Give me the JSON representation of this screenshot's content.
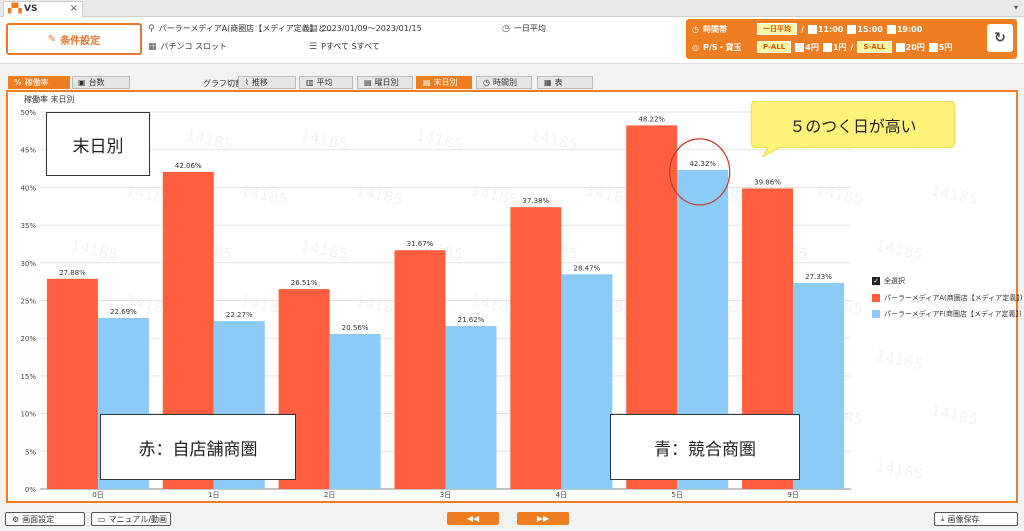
{
  "window": {
    "tab_title": "VS",
    "close": "×",
    "menu_arrow": "▾"
  },
  "header": {
    "condition_button": "条件設定",
    "store": "パーラーメディアA(商圏店【メディア定義】と...",
    "period": "2023/01/09～2023/01/15",
    "average": "一日平均",
    "machine_type": "パチンコ スロット",
    "machine_filter": "Pすべて Sすべて"
  },
  "time_panel": {
    "label_time": "時間帯",
    "time_options": [
      {
        "label": "一日平均",
        "selected": true
      },
      {
        "label": "11:00",
        "selected": false
      },
      {
        "label": "15:00",
        "selected": false
      },
      {
        "label": "19:00",
        "selected": false
      }
    ],
    "label_rate": "P/S・貸玉",
    "p_all": "P-ALL",
    "p_options": [
      "4円",
      "1円"
    ],
    "s_all": "S-ALL",
    "s_options": [
      "20円",
      "5円"
    ],
    "separator": "/"
  },
  "tabs": {
    "metric": [
      {
        "label": "稼働率",
        "active": true
      },
      {
        "label": "台数",
        "active": false
      }
    ],
    "graph_switch_label": "グラフ切替",
    "graph": [
      {
        "label": "推移",
        "active": false
      },
      {
        "label": "平均",
        "active": false
      },
      {
        "label": "曜日別",
        "active": false
      },
      {
        "label": "末日別",
        "active": true
      },
      {
        "label": "時間別",
        "active": false
      },
      {
        "label": "表",
        "active": false
      }
    ]
  },
  "chart_subtitle": "稼働率 末日別",
  "annotations": {
    "top_left": "末日別",
    "red_note": "赤：自店舗商圏",
    "blue_note": "青：競合商圏",
    "yellow_note": "５のつく日が高い"
  },
  "legend": {
    "select_all": "全選択",
    "items": [
      {
        "name": "パーラーメディアA(商圏店【メディア定義】)",
        "color": "#ff5f3f"
      },
      {
        "name": "パーラーメディアF(商圏店【メディア定義】)",
        "color": "#8ccbf5"
      }
    ]
  },
  "chart_data": {
    "type": "bar",
    "categories": [
      "0日",
      "1日",
      "2日",
      "3日",
      "4日",
      "5日",
      "9日"
    ],
    "series": [
      {
        "name": "パーラーメディアA(商圏店【メディア定義】)",
        "color": "#ff5f3f",
        "values": [
          27.88,
          42.06,
          26.51,
          31.67,
          37.38,
          48.22,
          39.86
        ],
        "labels": [
          "27.88%",
          "42.06%",
          "26.51%",
          "31.67%",
          "37.38%",
          "48.22%",
          "39.86%"
        ]
      },
      {
        "name": "パーラーメディアF(商圏店【メディア定義】)",
        "color": "#8ccbf5",
        "values": [
          22.69,
          22.27,
          20.56,
          21.62,
          28.47,
          42.32,
          27.33
        ],
        "labels": [
          "22.69%",
          "22.27%",
          "20.56%",
          "21.62%",
          "28.47%",
          "42.32%",
          "27.33%"
        ]
      }
    ],
    "highlighted": {
      "category": "5日",
      "series": "パーラーメディアF(商圏店【メディア定義】)"
    },
    "title": "",
    "xlabel": "",
    "ylabel": "",
    "ylim": [
      0,
      50
    ],
    "yticks": [
      0,
      5,
      10,
      15,
      20,
      25,
      30,
      35,
      40,
      45,
      50
    ],
    "ytick_labels": [
      "0%",
      "5%",
      "10%",
      "15%",
      "20%",
      "25%",
      "30%",
      "35%",
      "40%",
      "45%",
      "50%"
    ],
    "grid": true,
    "legend_position": "right",
    "watermark": "14185"
  },
  "footer": {
    "screen_settings": "画面設定",
    "manual": "マニュアル/動画",
    "prev": "◀◀",
    "next": "▶▶",
    "save_image": "画像保存"
  }
}
